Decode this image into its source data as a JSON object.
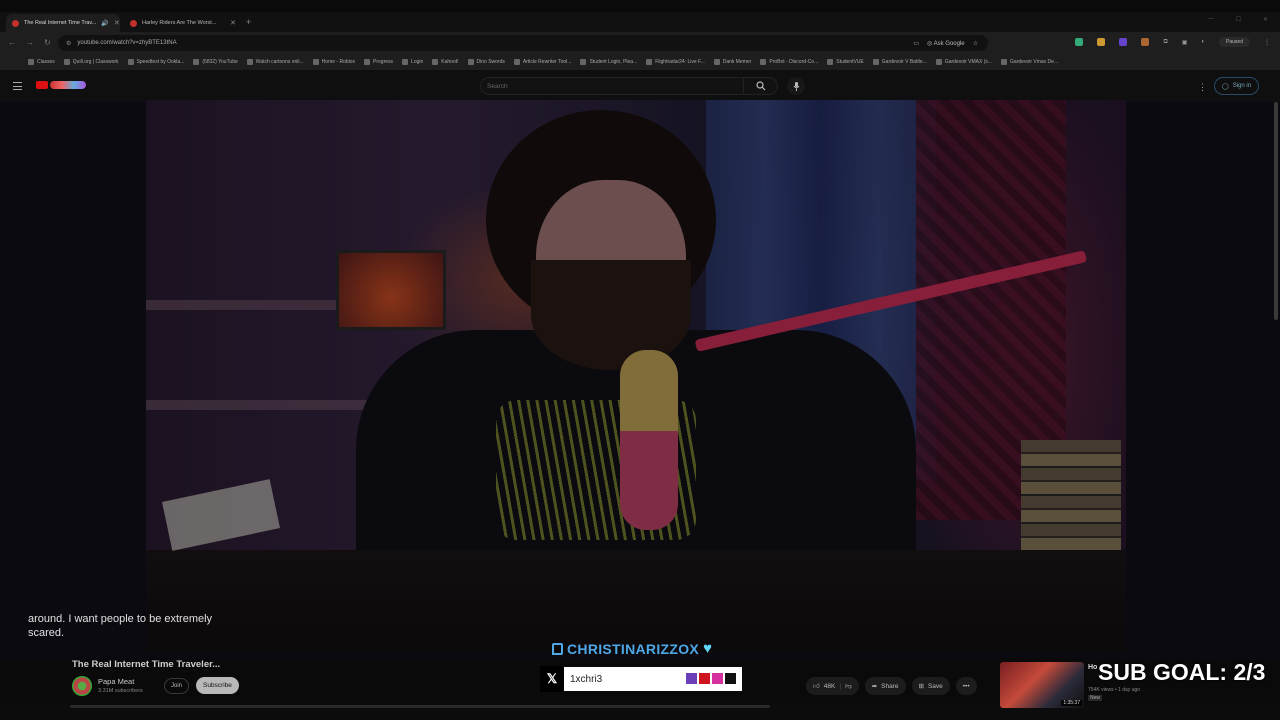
{
  "tabs": [
    {
      "label": "The Real Internet Time Trav...",
      "active": true
    },
    {
      "label": "Harley Riders Are The Worst...",
      "active": false
    }
  ],
  "address": {
    "url": "youtube.com/watch?v=zhyBTE13tNA",
    "ask_google": "Ask Google"
  },
  "profile": {
    "paused": "Paused"
  },
  "bookmarks": [
    "Classes",
    "Quill.org | Classwork",
    "Speedtest by Ookla...",
    "(5832) YouTube",
    "Watch cartoons onli...",
    "Home - Roblox",
    "Progress",
    "Login",
    "Kahoot!",
    "Dino Swords",
    "Article Rewriter Tool...",
    "Student Login, Plea...",
    "Flightradar24: Live F...",
    "Dank Memer",
    "ProBot - Discord-Co...",
    "StudentVUE",
    "Gardevoir V Battle...",
    "Gardevoir VMAX (s...",
    "Gardevoir Vmax De..."
  ],
  "youtube": {
    "search_placeholder": "Search",
    "sign_in": "Sign in"
  },
  "video": {
    "caption_line1": "around. I want people to be extremely",
    "caption_line2": "scared.",
    "title": "The Real Internet Time Traveler...",
    "channel_name": "Papa Meat",
    "channel_subs": "3.31M subscribers",
    "join_label": "Join",
    "subscribe_label": "Subscribe",
    "likes": "48K",
    "share_label": "Share",
    "save_label": "Save"
  },
  "overlay": {
    "twitch_name": "CHRISTINARIZZOX",
    "x_handle": "1xchri3",
    "swatch_colors": [
      "#6b3fb8",
      "#d0141f",
      "#d62fa0",
      "#111111"
    ],
    "sub_goal": "SUB GOAL: 2/3"
  },
  "suggestion": {
    "title": "Ho",
    "meta": "754K views • 1 day ago",
    "badge": "New",
    "duration": "1:35:37"
  }
}
